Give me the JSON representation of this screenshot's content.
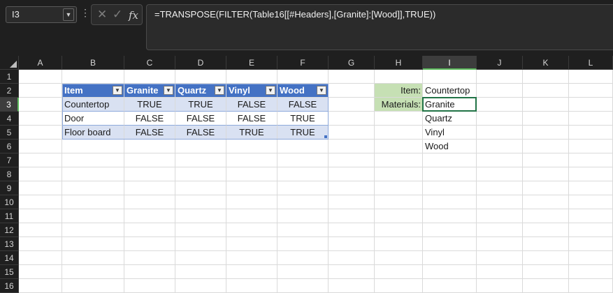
{
  "name_box": {
    "value": "I3"
  },
  "formula_bar": {
    "formula": "=TRANSPOSE(FILTER(Table16[[#Headers],[Granite]:[Wood]],TRUE))",
    "cancel_icon": "✕",
    "enter_icon": "✓",
    "function_icon": "fx"
  },
  "columns": [
    "A",
    "B",
    "C",
    "D",
    "E",
    "F",
    "G",
    "H",
    "I",
    "J",
    "K",
    "L"
  ],
  "rows": [
    "1",
    "2",
    "3",
    "4",
    "5",
    "6",
    "7",
    "8",
    "9",
    "10",
    "11",
    "12",
    "13",
    "14",
    "15",
    "16"
  ],
  "table": {
    "headers": [
      "Item",
      "Granite",
      "Quartz",
      "Vinyl",
      "Wood"
    ],
    "rows": [
      [
        "Countertop",
        "TRUE",
        "TRUE",
        "FALSE",
        "FALSE"
      ],
      [
        "Door",
        "FALSE",
        "FALSE",
        "FALSE",
        "TRUE"
      ],
      [
        "Floor board",
        "FALSE",
        "FALSE",
        "TRUE",
        "TRUE"
      ]
    ],
    "header_color": "#4472c4",
    "band_color": "#d9e1f2"
  },
  "lookup": {
    "item_label": "Item:",
    "item_value": "Countertop",
    "materials_label": "Materials:",
    "materials": [
      "Granite",
      "Quartz",
      "Vinyl",
      "Wood"
    ],
    "label_color": "#c6e0b4"
  },
  "selection": {
    "column": "I",
    "row": "3"
  }
}
